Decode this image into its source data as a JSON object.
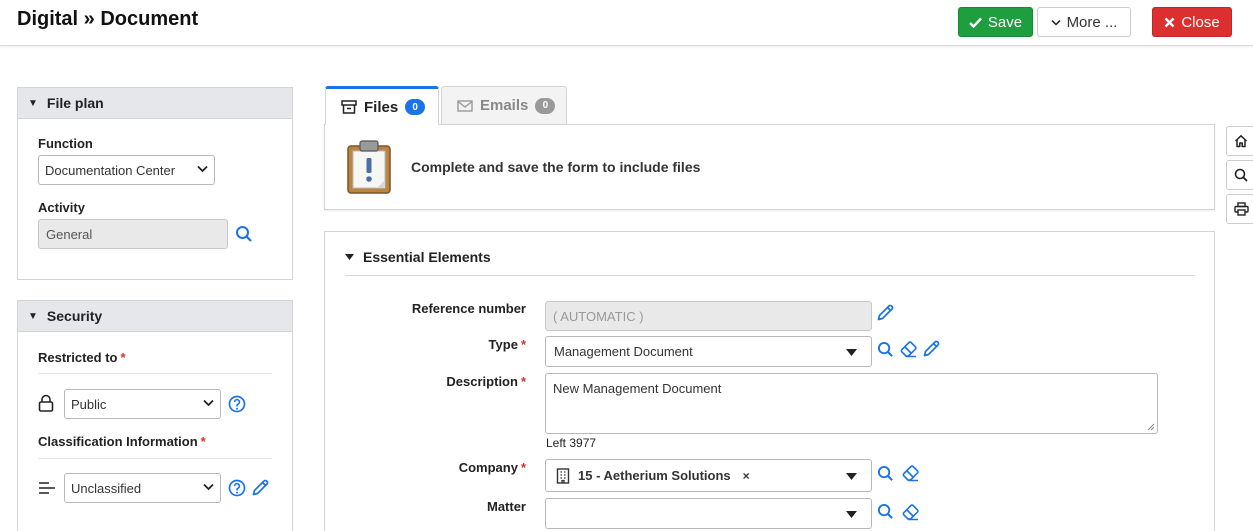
{
  "header": {
    "title": "Digital » Document",
    "save_label": "Save",
    "more_label": "More ...",
    "close_label": "Close"
  },
  "file_plan": {
    "title": "File plan",
    "function_label": "Function",
    "function_value": "Documentation Center",
    "activity_label": "Activity",
    "activity_value": "General"
  },
  "security": {
    "title": "Security",
    "restricted_label": "Restricted to",
    "restricted_value": "Public",
    "classification_label": "Classification Information",
    "classification_value": "Unclassified",
    "required_mark": "*"
  },
  "tabs": [
    {
      "label": "Files",
      "count": "0",
      "active": true
    },
    {
      "label": "Emails",
      "count": "0",
      "active": false
    }
  ],
  "files": {
    "message": "Complete and save the form to include files"
  },
  "essential": {
    "title": "Essential Elements",
    "reference_label": "Reference number",
    "reference_value": "( AUTOMATIC )",
    "type_label": "Type",
    "type_value": "Management Document",
    "description_label": "Description",
    "description_value": "New Management Document",
    "left_counter": "Left 3977",
    "company_label": "Company",
    "company_value": "15 - Aetherium Solutions",
    "company_clear": "×",
    "matter_label": "Matter",
    "matter_value": ""
  },
  "side_tools": [
    "home-icon",
    "search-icon",
    "print-icon"
  ],
  "colors": {
    "save": "#1e9e3e",
    "close": "#dc2f2f",
    "accent": "#1a73e8",
    "required": "#d93025"
  }
}
